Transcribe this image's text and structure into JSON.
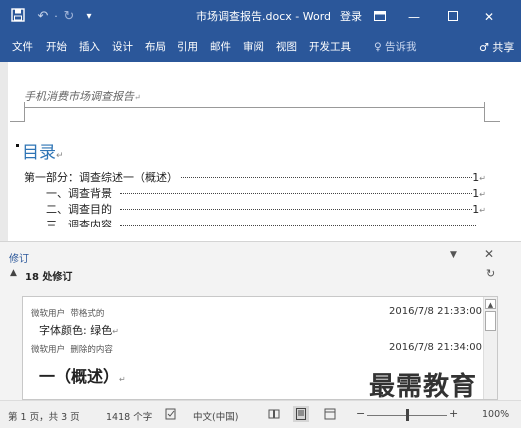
{
  "titlebar": {
    "title": "市场调查报告.docx - Word",
    "login": "登录",
    "icons": {
      "save": "save-icon",
      "undo": "undo-icon",
      "redo": "redo-icon",
      "customize": "customize-qat-icon",
      "ribbon_display": "ribbon-display-options-icon",
      "minimize": "minimize-icon",
      "restore": "restore-icon",
      "close": "close-icon"
    }
  },
  "ribbon": {
    "tabs": [
      {
        "label": "文件"
      },
      {
        "label": "开始"
      },
      {
        "label": "插入"
      },
      {
        "label": "设计"
      },
      {
        "label": "布局"
      },
      {
        "label": "引用"
      },
      {
        "label": "邮件"
      },
      {
        "label": "审阅"
      },
      {
        "label": "视图"
      },
      {
        "label": "开发工具"
      }
    ],
    "tell_me": "告诉我",
    "share": "共享"
  },
  "document": {
    "header": "手机消费市场调查报告",
    "paragraph_mark": "↵",
    "toc_title": "目录",
    "toc": [
      {
        "text": "第一部分：调查综述一（概述）",
        "page": "1"
      },
      {
        "text": "一、调查背景",
        "page": "1"
      },
      {
        "text": "二、调查目的",
        "page": "1"
      },
      {
        "text": "三、调查内容",
        "page": ""
      }
    ]
  },
  "revisions": {
    "pane_title": "修订",
    "count_label": "18 处修订",
    "items": [
      {
        "author": "微软用户",
        "type": "带格式的",
        "date": "2016/7/8 21:33:00",
        "content": "字体颜色: 绿色"
      },
      {
        "author": "微软用户",
        "type": "删除的内容",
        "date": "2016/7/8 21:34:00",
        "content": "一（概述）"
      }
    ]
  },
  "statusbar": {
    "page": "第 1 页，共 3 页",
    "words": "1418 个字",
    "language": "中文(中国)",
    "zoom": "100%",
    "zoom_level": 1.0
  },
  "watermark": "最需教育",
  "colors": {
    "accent": "#2b579a",
    "toc_heading": "#2e74b5"
  }
}
